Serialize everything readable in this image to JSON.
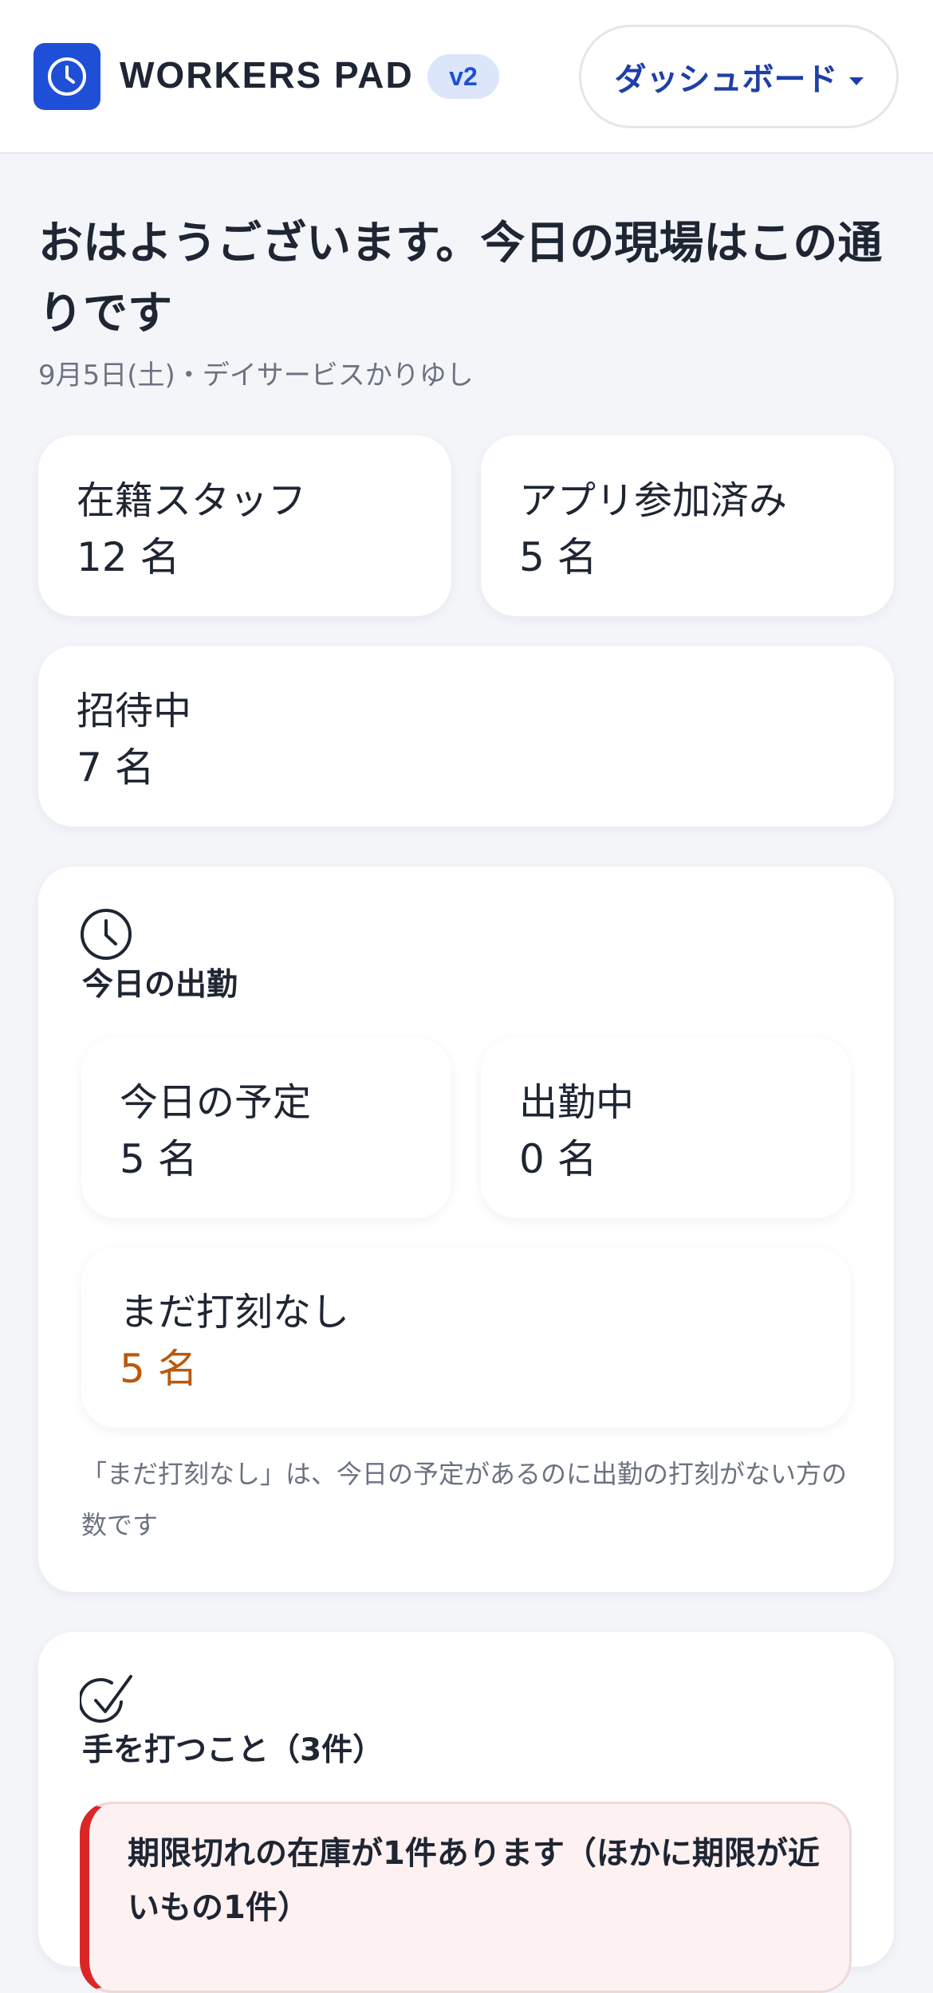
{
  "header": {
    "app_name": "WORKERS PAD",
    "version": "v2",
    "nav_selected": "ダッシュボード",
    "logo_icon": "clock-icon",
    "brand_color": "#1f4fd6"
  },
  "greeting": {
    "title": "おはようございます。今日の現場はこの通りです",
    "date_location": "9月5日(土)・デイサービスかりゆし"
  },
  "staff_stats": [
    {
      "label": "在籍スタッフ",
      "value": "12 名"
    },
    {
      "label": "アプリ参加済み",
      "value": "5 名"
    },
    {
      "label": "招待中",
      "value": "7 名"
    }
  ],
  "attendance": {
    "icon": "clock-icon",
    "title": "今日の出勤",
    "stats": [
      {
        "label": "今日の予定",
        "value": "5 名"
      },
      {
        "label": "出勤中",
        "value": "0 名"
      },
      {
        "label": "まだ打刻なし",
        "value": "5 名"
      }
    ],
    "note": "「まだ打刻なし」は、今日の予定があるのに出勤の打刻がない方の数です",
    "warn_color": "#b85a0d"
  },
  "todo": {
    "icon": "check-circle-icon",
    "title": "手を打つこと（3件）",
    "alert_text": "期限切れの在庫が1件あります（ほかに期限が近いもの1件）",
    "alert_color": "#dc2626"
  }
}
